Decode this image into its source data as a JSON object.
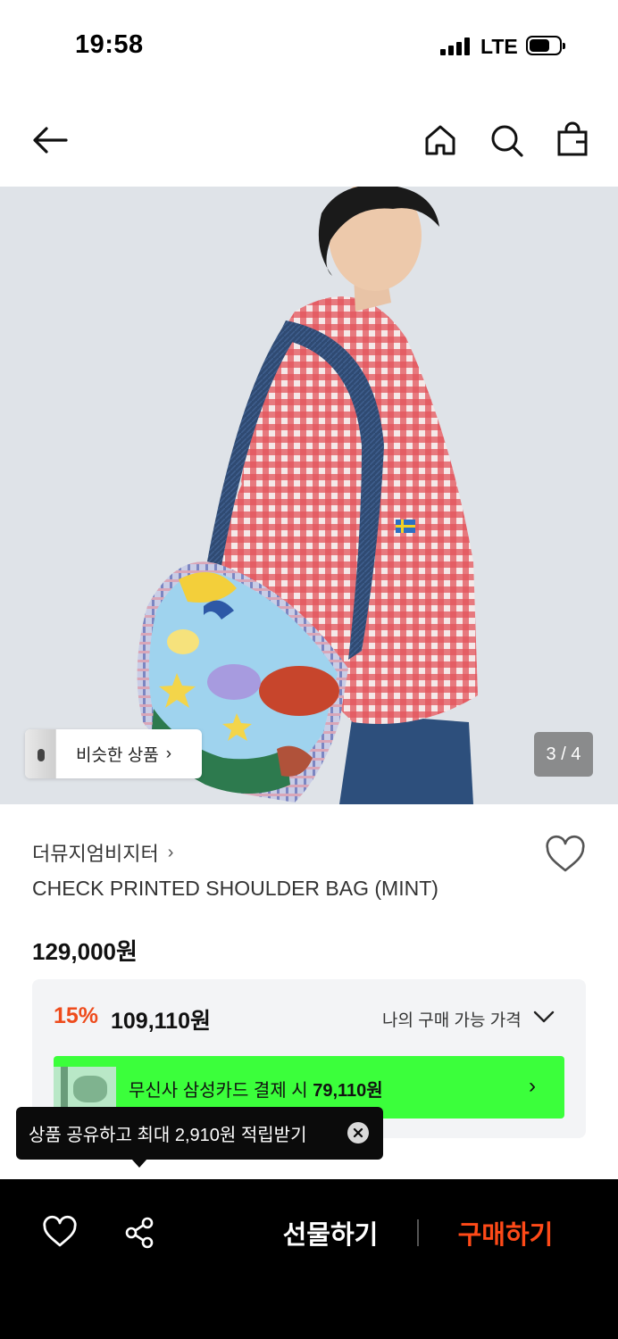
{
  "status_bar": {
    "time": "19:58",
    "network": "LTE"
  },
  "nav": {
    "icons": [
      "back-arrow-icon",
      "home-icon",
      "search-icon",
      "shopping-bag-icon"
    ]
  },
  "gallery": {
    "similar_label": "비슷한 상품",
    "page_indicator": "3 / 4",
    "current_page": 3,
    "total_pages": 4
  },
  "product": {
    "brand": "더뮤지엄비지터",
    "name": "CHECK PRINTED SHOULDER BAG (MINT)",
    "original_price": "129,000원",
    "discount_rate": "15%",
    "sale_price": "109,110원",
    "my_price_label": "나의 구매 가능 가격"
  },
  "card_promo": {
    "text": "무신사 삼성카드 결제 시",
    "price": "79,110원",
    "color": "#3bff3b"
  },
  "tooltip": {
    "text": "상품 공유하고 최대 2,910원 적립받기"
  },
  "bottom_bar": {
    "gift_label": "선물하기",
    "buy_label": "구매하기",
    "buy_color": "#ff4a18"
  }
}
